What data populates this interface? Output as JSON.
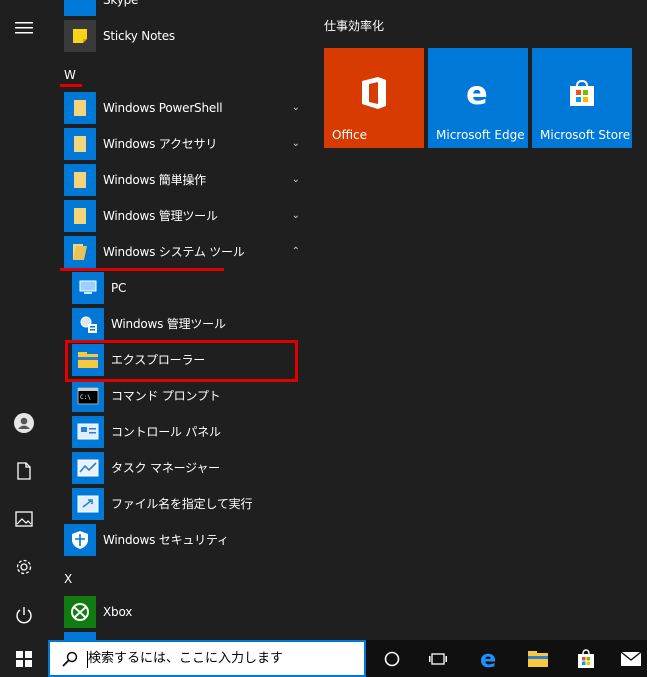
{
  "rail": {
    "icons": [
      "hamburger-icon",
      "user-icon",
      "document-icon",
      "pictures-icon",
      "settings-icon",
      "power-icon"
    ]
  },
  "apps": {
    "skype": "Skype",
    "sticky_notes": "Sticky Notes",
    "letter_w": "W",
    "powershell": "Windows PowerShell",
    "accessories": "Windows アクセサリ",
    "ease": "Windows 簡単操作",
    "admin_tools": "Windows 管理ツール",
    "system_tools": "Windows システム ツール",
    "sub": {
      "pc": "PC",
      "admin": "Windows 管理ツール",
      "explorer": "エクスプローラー",
      "cmd": "コマンド プロンプト",
      "control": "コントロール パネル",
      "task": "タスク マネージャー",
      "run": "ファイル名を指定して実行"
    },
    "security": "Windows セキュリティ",
    "letter_x": "X",
    "xbox": "Xbox"
  },
  "tiles": {
    "group_title": "仕事効率化",
    "items": [
      {
        "name": "Office",
        "color": "#d83b01"
      },
      {
        "name": "Microsoft Edge",
        "color": "#0078d7"
      },
      {
        "name": "Microsoft Store",
        "color": "#0078d7"
      }
    ]
  },
  "taskbar": {
    "search_placeholder": "検索するには、ここに入力します",
    "icons": [
      "windows-start-icon",
      "search-icon",
      "cortana-icon",
      "task-view-icon",
      "edge-icon",
      "file-explorer-icon",
      "store-icon",
      "mail-icon"
    ]
  },
  "colors": {
    "accent": "#0078d7",
    "highlight": "#e00000",
    "background": "#1f1f1f"
  }
}
